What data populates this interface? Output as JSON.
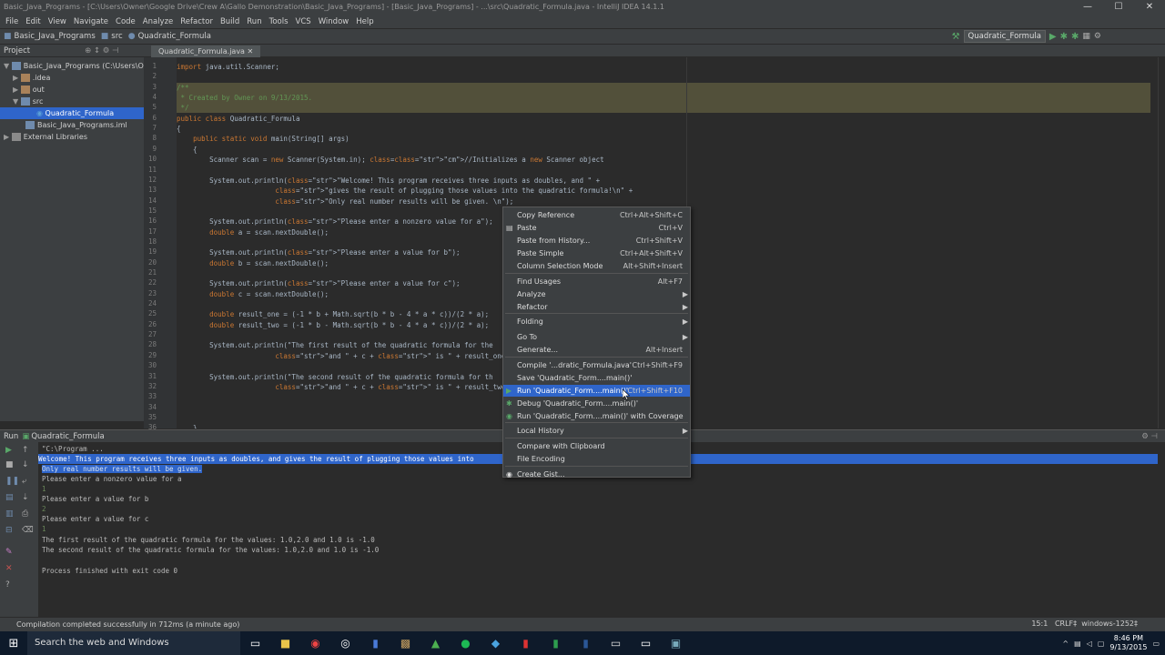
{
  "window": {
    "title": "Basic_Java_Programs - [C:\\Users\\Owner\\Google Drive\\Crew A\\Gallo Demonstration\\Basic_Java_Programs] - [Basic_Java_Programs] - ...\\src\\Quadratic_Formula.java - IntelliJ IDEA 14.1.1",
    "controls": [
      "—",
      "☐",
      "✕"
    ]
  },
  "menu": [
    "File",
    "Edit",
    "View",
    "Navigate",
    "Code",
    "Analyze",
    "Refactor",
    "Build",
    "Run",
    "Tools",
    "VCS",
    "Window",
    "Help"
  ],
  "breadcrumbs": [
    "Basic_Java_Programs",
    "src",
    "Quadratic_Formula"
  ],
  "run_config": "Quadratic_Formula",
  "project_panel": {
    "header": "Project",
    "items": [
      {
        "label": "Basic_Java_Programs (C:\\Users\\Own",
        "icon": "module-folder-icon"
      },
      {
        "label": ".idea",
        "icon": "folder-icon"
      },
      {
        "label": "out",
        "icon": "folder-icon"
      },
      {
        "label": "src",
        "icon": "source-folder-icon"
      },
      {
        "label": "Quadratic_Formula",
        "icon": "class-icon"
      },
      {
        "label": "Basic_Java_Programs.iml",
        "icon": "iml-file-icon"
      },
      {
        "label": "External Libraries",
        "icon": "library-icon"
      }
    ]
  },
  "editor": {
    "tab": "Quadratic_Formula.java",
    "line_numbers": [
      "1",
      "2",
      "3",
      "4",
      "5",
      "6",
      "7",
      "8",
      "9",
      "10",
      "11",
      "12",
      "13",
      "14",
      "15",
      "16",
      "17",
      "18",
      "19",
      "20",
      "21",
      "22",
      "23",
      "24",
      "25",
      "26",
      "27",
      "28",
      "29",
      "30",
      "31",
      "32",
      "33",
      "34",
      "35",
      "36"
    ],
    "lines": [
      "import java.util.Scanner;",
      "",
      "/**",
      " * Created by Owner on 9/13/2015.",
      " */",
      "public class Quadratic_Formula",
      "{",
      "    public static void main(String[] args)",
      "    {",
      "        Scanner scan = new Scanner(System.in); //Initializes a new Scanner object",
      "",
      "        System.out.println(\"Welcome! This program receives three inputs as doubles, and \" +",
      "                        \"gives the result of plugging those values into the quadratic formula!\\n\" +",
      "                        \"Only real number results will be given. \\n\");",
      "",
      "        System.out.println(\"Please enter a nonzero value for a\");",
      "        double a = scan.nextDouble();",
      "",
      "        System.out.println(\"Please enter a value for b\");",
      "        double b = scan.nextDouble();",
      "",
      "        System.out.println(\"Please enter a value for c\");",
      "        double c = scan.nextDouble();",
      "",
      "        double result_one = (-1 * b + Math.sqrt(b * b - 4 * a * c))/(2 * a);",
      "        double result_two = (-1 * b - Math.sqrt(b * b - 4 * a * c))/(2 * a);",
      "",
      "        System.out.println(\"The first result of the quadratic formula for the",
      "                        \"and \" + c + \" is \" + result_one);",
      "",
      "        System.out.println(\"The second result of the quadratic formula for th",
      "                        \"and \" + c + \" is \" + result_two);",
      "",
      "",
      "",
      "    }"
    ]
  },
  "run_panel": {
    "header": "Run",
    "config": "Quadratic_Formula",
    "console": [
      "\"C:\\Program ...",
      "Welcome! This program receives three inputs as doubles, and gives the result of plugging those values into",
      "Only real number results will be given.",
      "Please enter a nonzero value for a",
      "1",
      "Please enter a value for b",
      "2",
      "Please enter a value for c",
      "1",
      "The first result of the quadratic formula for the values: 1.0,2.0 and 1.0 is -1.0",
      "The second result of the quadratic formula for the values: 1.0,2.0 and 1.0 is -1.0",
      "",
      "Process finished with exit code 0"
    ]
  },
  "context_menu": {
    "items": [
      {
        "label": "Copy Reference",
        "shortcut": "Ctrl+Alt+Shift+C"
      },
      {
        "label": "Paste",
        "shortcut": "Ctrl+V",
        "icon": "paste-icon"
      },
      {
        "label": "Paste from History...",
        "shortcut": "Ctrl+Shift+V"
      },
      {
        "label": "Paste Simple",
        "shortcut": "Ctrl+Alt+Shift+V"
      },
      {
        "label": "Column Selection Mode",
        "shortcut": "Alt+Shift+Insert"
      },
      {
        "label": "Find Usages",
        "shortcut": "Alt+F7"
      },
      {
        "label": "Analyze",
        "submenu": true
      },
      {
        "label": "Refactor",
        "submenu": true
      },
      {
        "label": "Folding",
        "submenu": true
      },
      {
        "label": "Go To",
        "submenu": true
      },
      {
        "label": "Generate...",
        "shortcut": "Alt+Insert"
      },
      {
        "label": "Compile '...dratic_Formula.java'",
        "shortcut": "Ctrl+Shift+F9"
      },
      {
        "label": "Save 'Quadratic_Form....main()'"
      },
      {
        "label": "Run 'Quadratic_Form....main()'",
        "shortcut": "Ctrl+Shift+F10",
        "icon": "run-icon"
      },
      {
        "label": "Debug 'Quadratic_Form....main()'",
        "icon": "debug-icon"
      },
      {
        "label": "Run 'Quadratic_Form....main()' with Coverage",
        "icon": "coverage-icon"
      },
      {
        "label": "Local History",
        "submenu": true
      },
      {
        "label": "Compare with Clipboard"
      },
      {
        "label": "File Encoding"
      },
      {
        "label": "Create Gist...",
        "icon": "github-icon"
      }
    ]
  },
  "status": {
    "message": "Compilation completed successfully in 712ms (a minute ago)",
    "position": "15:1",
    "line_sep": "CRLF‡",
    "encoding": "windows-1252‡"
  },
  "taskbar": {
    "search": "Search the web and Windows",
    "time": "8:46 PM",
    "date": "9/13/2015"
  },
  "colors": {
    "selection": "#2f65ca",
    "editor_bg": "#2b2b2b",
    "panel_bg": "#3c3f41",
    "keyword": "#cc7832",
    "string": "#6a8759"
  }
}
